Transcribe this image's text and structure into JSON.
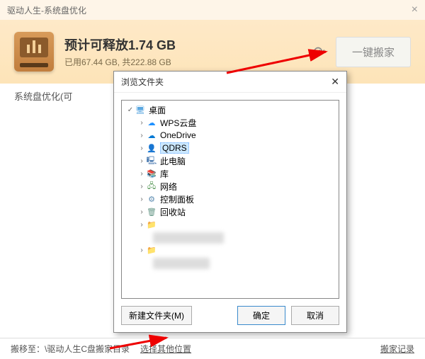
{
  "titlebar": {
    "title": "驱动人生-系统盘优化"
  },
  "header": {
    "title": "预计可释放1.74 GB",
    "usage": "已用67.44 GB, 共222.88 GB",
    "move_btn": "一键搬家"
  },
  "subheader": {
    "text": "系统盘优化(可"
  },
  "dialog": {
    "title": "浏览文件夹",
    "tree": {
      "root": "桌面",
      "items": [
        {
          "label": "WPS云盘",
          "icon": "cloud"
        },
        {
          "label": "OneDrive",
          "icon": "onedrive"
        },
        {
          "label": "QDRS",
          "icon": "user",
          "selected": true
        },
        {
          "label": "此电脑",
          "icon": "pc"
        },
        {
          "label": "库",
          "icon": "lib"
        },
        {
          "label": "网络",
          "icon": "net"
        },
        {
          "label": "控制面板",
          "icon": "ctrl"
        },
        {
          "label": "回收站",
          "icon": "recycle"
        }
      ]
    },
    "new_folder": "新建文件夹(M)",
    "ok": "确定",
    "cancel": "取消"
  },
  "footer": {
    "move_to": "搬移至：",
    "path": "\\驱动人生C盘搬家目录",
    "choose_other": "选择其他位置",
    "history": "搬家记录"
  }
}
